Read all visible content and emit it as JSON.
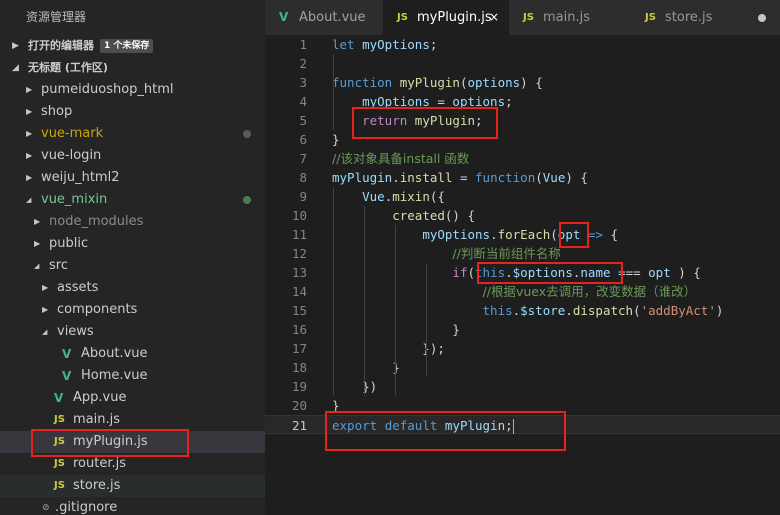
{
  "sidebar": {
    "title": "资源管理器",
    "open_editors": {
      "label": "打开的编辑器",
      "badge": "1 个未保存"
    },
    "workspace": {
      "label": "无标题 (工作区)"
    },
    "tree": [
      {
        "label": "pumeiduoshop_html",
        "kind": "folder",
        "expanded": false,
        "depth": 0,
        "status": ""
      },
      {
        "label": "shop",
        "kind": "folder",
        "expanded": false,
        "depth": 0,
        "status": ""
      },
      {
        "label": "vue-mark",
        "kind": "folder",
        "expanded": false,
        "depth": 0,
        "status": "modified",
        "dot": "gray"
      },
      {
        "label": "vue-login",
        "kind": "folder",
        "expanded": false,
        "depth": 0,
        "status": ""
      },
      {
        "label": "weiju_html2",
        "kind": "folder",
        "expanded": false,
        "depth": 0,
        "status": ""
      },
      {
        "label": "vue_mixin",
        "kind": "folder",
        "expanded": true,
        "depth": 0,
        "status": "untracked",
        "dot": "green"
      },
      {
        "label": "node_modules",
        "kind": "folder",
        "expanded": false,
        "depth": 1,
        "status": "ignored"
      },
      {
        "label": "public",
        "kind": "folder",
        "expanded": false,
        "depth": 1,
        "status": ""
      },
      {
        "label": "src",
        "kind": "folder",
        "expanded": true,
        "depth": 1,
        "status": ""
      },
      {
        "label": "assets",
        "kind": "folder",
        "expanded": false,
        "depth": 2,
        "status": ""
      },
      {
        "label": "components",
        "kind": "folder",
        "expanded": false,
        "depth": 2,
        "status": ""
      },
      {
        "label": "views",
        "kind": "folder",
        "expanded": true,
        "depth": 2,
        "status": ""
      },
      {
        "label": "About.vue",
        "kind": "vue",
        "depth": 3,
        "status": ""
      },
      {
        "label": "Home.vue",
        "kind": "vue",
        "depth": 3,
        "status": ""
      },
      {
        "label": "App.vue",
        "kind": "vue",
        "depth": 2,
        "status": ""
      },
      {
        "label": "main.js",
        "kind": "js",
        "depth": 2,
        "status": ""
      },
      {
        "label": "myPlugin.js",
        "kind": "js",
        "depth": 2,
        "status": "",
        "selected": true
      },
      {
        "label": "router.js",
        "kind": "js",
        "depth": 2,
        "status": ""
      },
      {
        "label": "store.js",
        "kind": "js",
        "depth": 2,
        "status": "",
        "hover": true
      },
      {
        "label": ".gitignore",
        "kind": "file",
        "depth": 1,
        "status": ""
      }
    ]
  },
  "tabs": [
    {
      "label": "About.vue",
      "icon": "V",
      "kind": "vue",
      "active": false
    },
    {
      "label": "myPlugin.js",
      "icon": "JS",
      "kind": "js",
      "active": true,
      "close": "×"
    },
    {
      "label": "main.js",
      "icon": "JS",
      "kind": "js",
      "active": false
    },
    {
      "label": "store.js",
      "icon": "JS",
      "kind": "js",
      "active": false,
      "dirty": true
    }
  ],
  "colors": {
    "keyword": "#569cd6",
    "control": "#c586c0",
    "variable": "#9cdcfe",
    "function": "#dcdcaa",
    "string": "#ce9178",
    "comment": "#6a9955",
    "plain": "#d4d4d4",
    "annotation": "#e8221d"
  },
  "code_lines": [
    {
      "num": "1",
      "tokens": [
        [
          "kw",
          "let "
        ],
        [
          "var",
          "myOptions"
        ],
        [
          "pl",
          ";"
        ]
      ]
    },
    {
      "num": "2",
      "tokens": []
    },
    {
      "num": "3",
      "tokens": [
        [
          "kw",
          "function "
        ],
        [
          "fn",
          "myPlugin"
        ],
        [
          "pl",
          "("
        ],
        [
          "var",
          "options"
        ],
        [
          "pl",
          ") {"
        ]
      ]
    },
    {
      "num": "4",
      "tokens": [
        [
          "pl",
          "    "
        ],
        [
          "var",
          "myOptions"
        ],
        [
          "pl",
          " = "
        ],
        [
          "var",
          "options"
        ],
        [
          "pl",
          ";"
        ]
      ]
    },
    {
      "num": "5",
      "tokens": [
        [
          "pl",
          "    "
        ],
        [
          "ctl",
          "return "
        ],
        [
          "fn",
          "myPlugin"
        ],
        [
          "pl",
          ";"
        ]
      ]
    },
    {
      "num": "6",
      "tokens": [
        [
          "pl",
          "}"
        ]
      ]
    },
    {
      "num": "7",
      "tokens": [
        [
          "cm",
          "//该对象具备install 函数"
        ]
      ]
    },
    {
      "num": "8",
      "tokens": [
        [
          "var",
          "myPlugin"
        ],
        [
          "pl",
          "."
        ],
        [
          "fn",
          "install"
        ],
        [
          "pl",
          " = "
        ],
        [
          "kw",
          "function"
        ],
        [
          "pl",
          "("
        ],
        [
          "var",
          "Vue"
        ],
        [
          "pl",
          ") {"
        ]
      ]
    },
    {
      "num": "9",
      "tokens": [
        [
          "pl",
          "    "
        ],
        [
          "var",
          "Vue"
        ],
        [
          "pl",
          "."
        ],
        [
          "fn",
          "mixin"
        ],
        [
          "pl",
          "({"
        ]
      ]
    },
    {
      "num": "10",
      "tokens": [
        [
          "pl",
          "        "
        ],
        [
          "fn",
          "created"
        ],
        [
          "pl",
          "() {"
        ]
      ]
    },
    {
      "num": "11",
      "tokens": [
        [
          "pl",
          "            "
        ],
        [
          "var",
          "myOptions"
        ],
        [
          "pl",
          "."
        ],
        [
          "fn",
          "forEach"
        ],
        [
          "pl",
          "("
        ],
        [
          "var",
          "opt"
        ],
        [
          "pl",
          " "
        ],
        [
          "kw",
          "=>"
        ],
        [
          "pl",
          " {"
        ]
      ]
    },
    {
      "num": "12",
      "tokens": [
        [
          "pl",
          "                "
        ],
        [
          "cm",
          "//判断当前组件名称"
        ]
      ]
    },
    {
      "num": "13",
      "tokens": [
        [
          "pl",
          "                "
        ],
        [
          "ctl",
          "if"
        ],
        [
          "pl",
          "("
        ],
        [
          "kw",
          "this"
        ],
        [
          "pl",
          "."
        ],
        [
          "var",
          "$options"
        ],
        [
          "pl",
          "."
        ],
        [
          "var",
          "name"
        ],
        [
          "pl",
          " === "
        ],
        [
          "var",
          "opt"
        ],
        [
          "pl",
          " ) {"
        ]
      ]
    },
    {
      "num": "14",
      "tokens": [
        [
          "pl",
          "                    "
        ],
        [
          "cm",
          "//根据vuex去调用，改变数据（谁改）"
        ]
      ]
    },
    {
      "num": "15",
      "tokens": [
        [
          "pl",
          "                    "
        ],
        [
          "kw",
          "this"
        ],
        [
          "pl",
          "."
        ],
        [
          "var",
          "$store"
        ],
        [
          "pl",
          "."
        ],
        [
          "fn",
          "dispatch"
        ],
        [
          "pl",
          "("
        ],
        [
          "str",
          "'addByAct'"
        ],
        [
          "pl",
          ")"
        ]
      ]
    },
    {
      "num": "16",
      "tokens": [
        [
          "pl",
          "                }"
        ]
      ]
    },
    {
      "num": "17",
      "tokens": [
        [
          "pl",
          "            });"
        ]
      ]
    },
    {
      "num": "18",
      "tokens": [
        [
          "pl",
          "        }"
        ]
      ]
    },
    {
      "num": "19",
      "tokens": [
        [
          "pl",
          "    })"
        ]
      ]
    },
    {
      "num": "20",
      "tokens": [
        [
          "pl",
          "}"
        ]
      ]
    },
    {
      "num": "21",
      "tokens": [
        [
          "kw",
          "export "
        ],
        [
          "kw",
          "default "
        ],
        [
          "var",
          "myPlugin"
        ],
        [
          "pl",
          ";"
        ]
      ],
      "current": true,
      "cursor": true
    }
  ]
}
